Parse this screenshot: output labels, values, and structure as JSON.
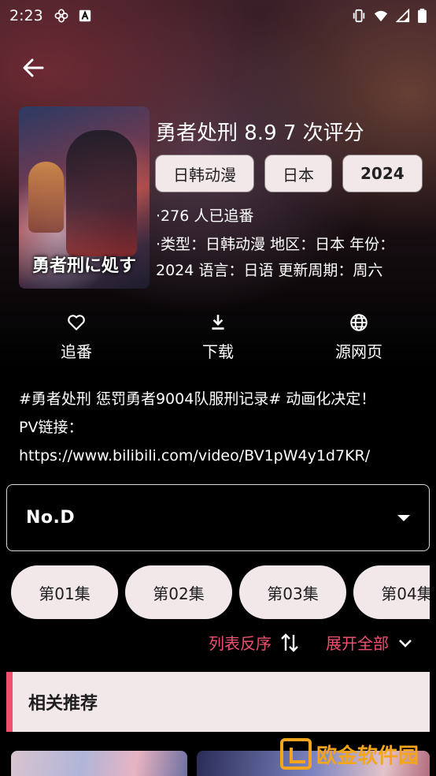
{
  "status": {
    "time": "2:23",
    "left_icons": [
      "pinwheel-icon",
      "font-a-icon"
    ],
    "right_icons": [
      "vibrate-icon",
      "wifi-icon",
      "signal-icon",
      "battery-icon"
    ]
  },
  "nav": {
    "back_icon": "arrow-left-icon"
  },
  "anime": {
    "poster_title": "勇者刑に処す",
    "title": "勇者处刑 8.9 7 次评分",
    "chips": [
      "日韩动漫",
      "日本",
      "2024"
    ],
    "followers": "·276 人已追番",
    "meta": "·类型：日韩动漫 地区：日本 年份：2024 语言：日语 更新周期：周六"
  },
  "actions": [
    {
      "label": "追番",
      "icon": "heart-icon"
    },
    {
      "label": "下载",
      "icon": "download-icon"
    },
    {
      "label": "源网页",
      "icon": "globe-icon"
    }
  ],
  "description": {
    "line1": "#勇者处刑 惩罚勇者9004队服刑记录# 动画化决定！",
    "line2": "PV链接：",
    "line3": "https://www.bilibili.com/video/BV1pW4y1d7KR/"
  },
  "source_select": {
    "value": "No.D"
  },
  "episodes": [
    "第01集",
    "第02集",
    "第03集",
    "第04集"
  ],
  "controls": {
    "reverse_label": "列表反序",
    "expand_label": "展开全部"
  },
  "recommend": {
    "title": "相关推荐"
  },
  "watermark": {
    "text": "欧金软件园"
  },
  "colors": {
    "accent": "#f0506e",
    "chip_bg": "#f2e8ea",
    "watermark": "#f3a51c"
  }
}
